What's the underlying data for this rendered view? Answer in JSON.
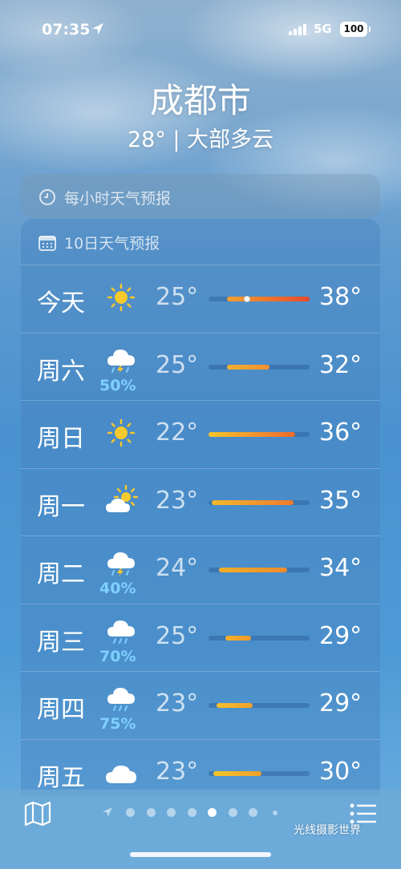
{
  "status_bar": {
    "time": "07:35",
    "network": "5G",
    "battery": "100",
    "icons": [
      "location-arrow-icon",
      "signal-bars-icon",
      "battery-icon"
    ]
  },
  "city": "成都市",
  "current_summary": "28° | 大部多云",
  "hourly": {
    "icon": "clock-icon",
    "label": "每小时天气预报"
  },
  "forecast": {
    "icon": "calendar-icon",
    "header": "10日天气预报",
    "days": [
      {
        "day": "今天",
        "icon": "sun-icon",
        "precip": "",
        "low": "25°",
        "high": "38°",
        "range": [
          0.18,
          1.0
        ],
        "current_marker": 0.38,
        "colors": [
          "#f0a030",
          "#e84a2c"
        ]
      },
      {
        "day": "周六",
        "icon": "thunderstorm-icon",
        "precip": "50%",
        "low": "25°",
        "high": "32°",
        "range": [
          0.18,
          0.6
        ],
        "colors": [
          "#f0b030",
          "#f09030"
        ]
      },
      {
        "day": "周日",
        "icon": "sun-icon",
        "precip": "",
        "low": "22°",
        "high": "36°",
        "range": [
          0.0,
          0.86
        ],
        "colors": [
          "#f5c52a",
          "#ee6a2c"
        ]
      },
      {
        "day": "周一",
        "icon": "partly-sunny-icon",
        "precip": "",
        "low": "23°",
        "high": "35°",
        "range": [
          0.03,
          0.84
        ],
        "colors": [
          "#f5b82a",
          "#ee7a2c"
        ]
      },
      {
        "day": "周二",
        "icon": "thunderstorm-icon",
        "precip": "40%",
        "low": "24°",
        "high": "34°",
        "range": [
          0.1,
          0.78
        ],
        "colors": [
          "#f5b02a",
          "#ee8a2c"
        ]
      },
      {
        "day": "周三",
        "icon": "rain-cloud-icon",
        "precip": "70%",
        "low": "25°",
        "high": "29°",
        "range": [
          0.17,
          0.42
        ],
        "colors": [
          "#f5b02a",
          "#f09a2c"
        ]
      },
      {
        "day": "周四",
        "icon": "rain-cloud-icon",
        "precip": "75%",
        "low": "23°",
        "high": "29°",
        "range": [
          0.08,
          0.44
        ],
        "colors": [
          "#f5c02a",
          "#f0a02c"
        ]
      },
      {
        "day": "周五",
        "icon": "cloud-icon",
        "precip": "",
        "low": "23°",
        "high": "30°",
        "range": [
          0.05,
          0.52
        ],
        "colors": [
          "#f5c52a",
          "#f0a02c"
        ]
      }
    ]
  },
  "bottom_bar": {
    "map_icon": "map-icon",
    "list_icon": "list-icon",
    "page_dots": 9,
    "active_page": 6
  },
  "watermark": "光线摄影世界"
}
